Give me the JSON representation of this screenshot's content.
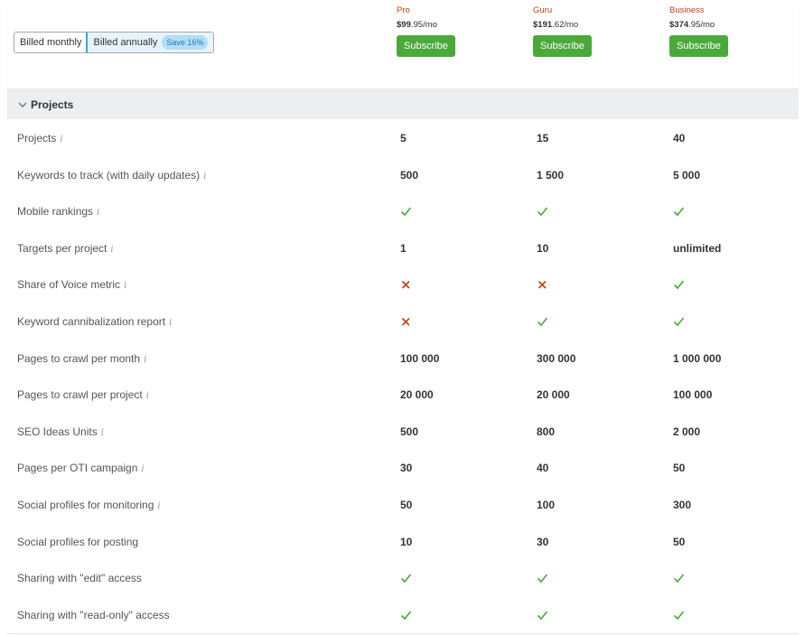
{
  "billing": {
    "monthly_label": "Billed monthly",
    "annual_label": "Billed annually",
    "save_badge": "Save 16%"
  },
  "plans": [
    {
      "name": "Pro",
      "price_main": "$99",
      "price_cents": ".95",
      "price_unit": "/mo",
      "button": "Subscribe"
    },
    {
      "name": "Guru",
      "price_main": "$191",
      "price_cents": ".62",
      "price_unit": "/mo",
      "button": "Subscribe"
    },
    {
      "name": "Business",
      "price_main": "$374",
      "price_cents": ".95",
      "price_unit": "/mo",
      "button": "Subscribe"
    }
  ],
  "section": {
    "title": "Projects"
  },
  "colors": {
    "accent_orange": "#c1401b",
    "button_green": "#4aa93a",
    "check_green": "#4aa93a",
    "cross_red": "#c1401b"
  },
  "rows": [
    {
      "label": "Projects",
      "info": true,
      "values": [
        "5",
        "15",
        "40"
      ]
    },
    {
      "label": "Keywords to track (with daily updates)",
      "info": true,
      "values": [
        "500",
        "1 500",
        "5 000"
      ]
    },
    {
      "label": "Mobile rankings",
      "info": true,
      "values": [
        "check",
        "check",
        "check"
      ]
    },
    {
      "label": "Targets per project",
      "info": true,
      "values": [
        "1",
        "10",
        "unlimited"
      ]
    },
    {
      "label": "Share of Voice metric",
      "info": true,
      "values": [
        "cross",
        "cross",
        "check"
      ]
    },
    {
      "label": "Keyword cannibalization report",
      "info": true,
      "values": [
        "cross",
        "check",
        "check"
      ]
    },
    {
      "label": "Pages to crawl per month",
      "info": true,
      "values": [
        "100 000",
        "300 000",
        "1 000 000"
      ]
    },
    {
      "label": "Pages to crawl per project",
      "info": true,
      "values": [
        "20 000",
        "20 000",
        "100 000"
      ]
    },
    {
      "label": "SEO Ideas Units",
      "info": true,
      "values": [
        "500",
        "800",
        "2 000"
      ]
    },
    {
      "label": "Pages per OTI campaign",
      "info": true,
      "values": [
        "30",
        "40",
        "50"
      ]
    },
    {
      "label": "Social profiles for monitoring",
      "info": true,
      "values": [
        "50",
        "100",
        "300"
      ]
    },
    {
      "label": "Social profiles for posting",
      "info": false,
      "values": [
        "10",
        "30",
        "50"
      ]
    },
    {
      "label": "Sharing with \"edit\" access",
      "info": false,
      "values": [
        "check",
        "check",
        "check"
      ]
    },
    {
      "label": "Sharing with \"read-only\" access",
      "info": false,
      "values": [
        "check",
        "check",
        "check"
      ]
    }
  ]
}
